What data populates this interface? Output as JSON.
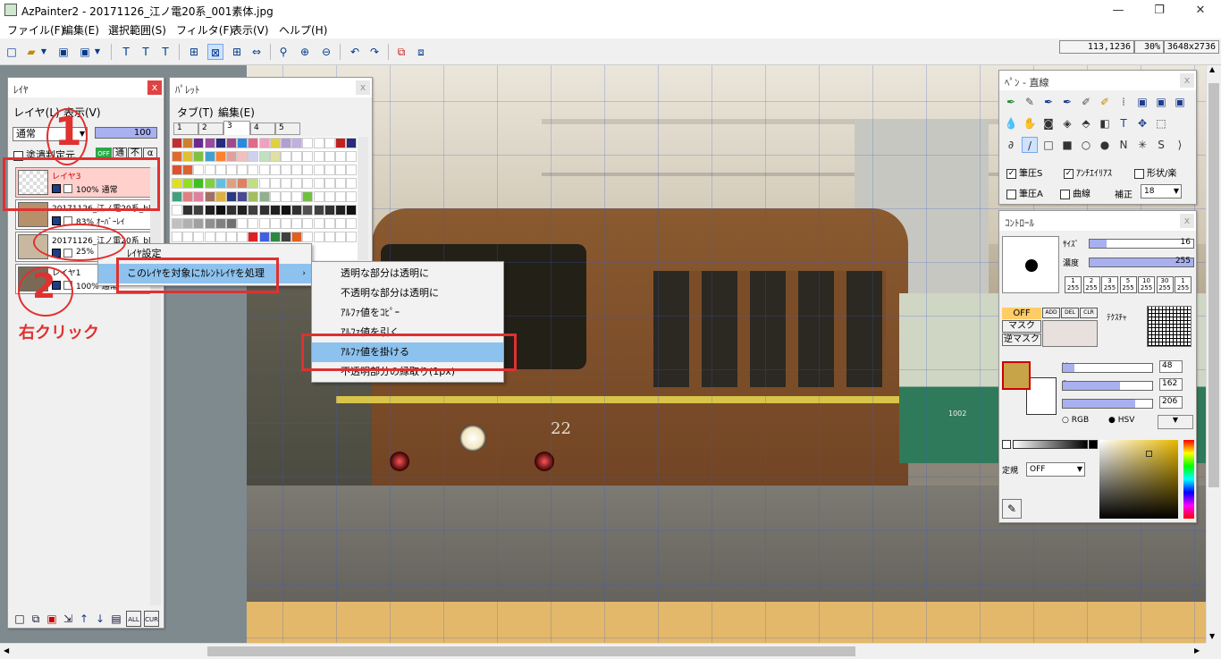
{
  "window": {
    "title": "AzPainter2 - 20171126_江ノ電20系_001素体.jpg",
    "minimize": "—",
    "maximize": "❐",
    "close": "✕"
  },
  "menu": [
    "ファイル(F)",
    "編集(E)",
    "選択範囲(S)",
    "フィルタ(F)",
    "表示(V)",
    "ヘルプ(H)"
  ],
  "status": {
    "coords": "113,1236",
    "zoom": "30%",
    "size": "3648x2736"
  },
  "layer_panel": {
    "title": "ﾚｲﾔ",
    "menu": [
      "レイヤ(L)",
      "表示(V)"
    ],
    "blend_mode": "通常",
    "opacity": "100",
    "fill_ref_label": "塗潰判定元",
    "mode_buttons": [
      "OFF",
      "通",
      "不",
      "α"
    ],
    "layers": [
      {
        "name": "レイヤ3",
        "info": "100% 通常"
      },
      {
        "name": "20171126_江ノ電20系_blog",
        "info": "83% ｵｰﾊﾞｰﾚｲ"
      },
      {
        "name": "20171126_江ノ電20系_blog",
        "info": "25%"
      },
      {
        "name": "レイヤ1",
        "info": "100% 通常"
      }
    ],
    "bottom_buttons": [
      "ALL",
      "CUR"
    ]
  },
  "palette_panel": {
    "title": "ﾊﾟﾚｯﾄ",
    "menu": [
      "タブ(T)",
      "編集(E)"
    ],
    "tabs": [
      "1",
      "2",
      "3",
      "4",
      "5"
    ],
    "active_tab": "3"
  },
  "context_menu": {
    "items": [
      "ﾚｲﾔ設定",
      "このﾚｲﾔを対象にｶﾚﾝﾄﾚｲﾔを処理"
    ],
    "submenu": [
      "透明な部分は透明に",
      "不透明な部分は透明に",
      "ｱﾙﾌｧ値をｺﾋﾟｰ",
      "ｱﾙﾌｧ値を引く",
      "ｱﾙﾌｧ値を掛ける",
      "不透明部分の縁取り(1px)"
    ],
    "highlighted": "ｱﾙﾌｧ値を掛ける"
  },
  "annotations": {
    "step1": "1",
    "step2": "2",
    "right_click": "右クリック"
  },
  "pen_panel": {
    "title": "ﾍﾟﾝ - 直線",
    "options": {
      "pressure_s": "筆圧S",
      "antialias": "ｱﾝﾁｴｲﾘｱｽ",
      "shape": "形状/楽",
      "pressure_a": "筆圧A",
      "curve": "曲線",
      "correction": "補正",
      "correction_value": "18"
    }
  },
  "control_panel": {
    "title": "ｺﾝﾄﾛｰﾙ",
    "size_label": "ｻｲｽﾞ",
    "size_value": "16",
    "size_fraction": 0.16,
    "density_label": "濃度",
    "density_value": "255",
    "density_fraction": 1.0,
    "presets": [
      [
        "1",
        "255"
      ],
      [
        "2",
        "255"
      ],
      [
        "3",
        "255"
      ],
      [
        "5",
        "255"
      ],
      [
        "10",
        "255"
      ],
      [
        "30",
        "255"
      ],
      [
        "1",
        "255"
      ]
    ],
    "mask_off": "OFF",
    "mask": "マスク",
    "reverse_mask": "逆マスク",
    "mask_buttons": [
      "ADD",
      "DEL",
      "CLR"
    ],
    "texture_label": "ﾃｸｽﾁｬ",
    "h_label": "H",
    "h_value": "48",
    "h_fraction": 0.13,
    "s_label": "S",
    "s_value": "162",
    "s_fraction": 0.64,
    "v_label": "V",
    "v_value": "206",
    "v_fraction": 0.81,
    "rgb_label": "RGB",
    "hsv_label": "HSV",
    "fixed_label": "定規",
    "fixed_value": "OFF",
    "fg_color": "#c8a448",
    "bg_color": "#ffffff"
  },
  "canvas": {
    "car_number": "22",
    "side_car_number": "1002"
  }
}
